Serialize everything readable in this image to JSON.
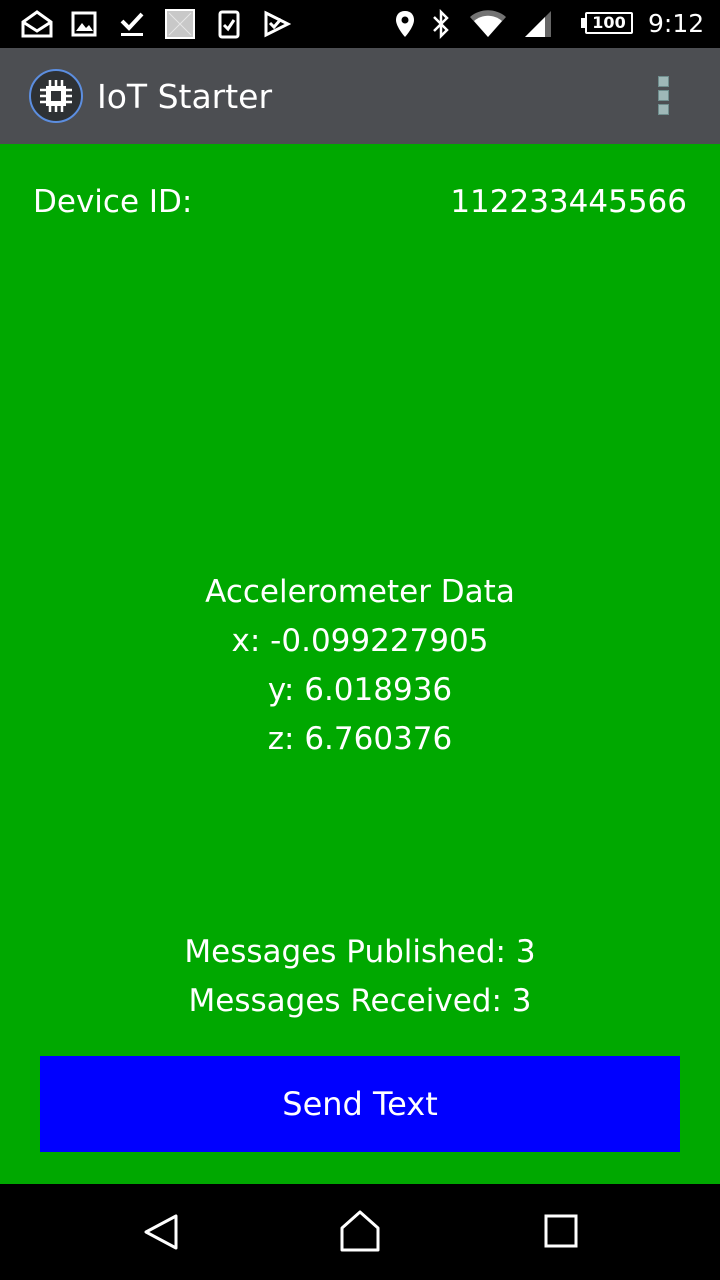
{
  "status_bar": {
    "notification_icons": [
      "mail-icon",
      "image-icon",
      "download-done-icon",
      "app-tile-icon",
      "clipboard-check-icon",
      "task-check-icon"
    ],
    "system_icons": [
      "location-icon",
      "bluetooth-icon",
      "wifi-icon",
      "cell-signal-icon"
    ],
    "battery": "100",
    "time": "9:12"
  },
  "app_bar": {
    "title": "IoT Starter",
    "logo_icon": "chip-icon",
    "menu_icon": "overflow-menu-icon",
    "background_color": "#4c4e52"
  },
  "device": {
    "label": "Device ID:",
    "value": "112233445566"
  },
  "accelerometer": {
    "title": "Accelerometer Data",
    "x": "x: -0.099227905",
    "y": "y: 6.018936",
    "z": "z: 6.760376"
  },
  "messages": {
    "published": "Messages Published: 3",
    "received": "Messages Received: 3"
  },
  "send_button": {
    "label": "Send Text",
    "color": "#0000ff"
  },
  "navigation": {
    "back_icon": "back-icon",
    "home_icon": "home-icon",
    "recents_icon": "recents-icon"
  },
  "theme": {
    "background": "#00a800",
    "text": "#ffffff"
  }
}
